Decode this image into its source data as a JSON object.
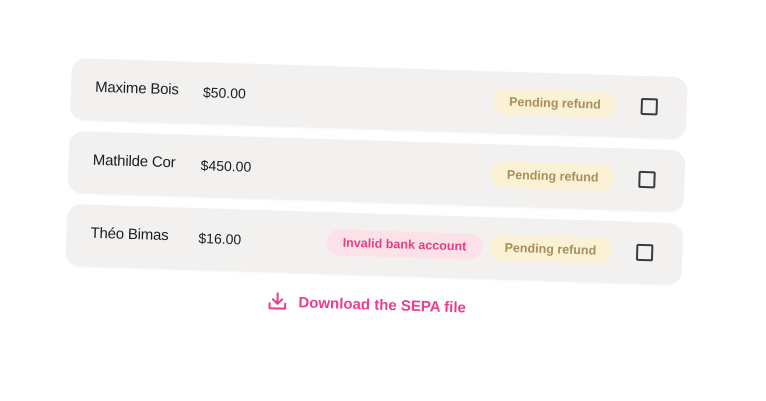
{
  "rows": [
    {
      "name": "Maxime Bois",
      "amount": "$50.00",
      "status": "Pending refund",
      "error": null
    },
    {
      "name": "Mathilde Cor",
      "amount": "$450.00",
      "status": "Pending refund",
      "error": null
    },
    {
      "name": "Théo Bimas",
      "amount": "$16.00",
      "status": "Pending refund",
      "error": "Invalid bank account"
    }
  ],
  "download_label": "Download the SEPA file",
  "icons": {
    "download": "download-icon",
    "checkbox": "checkbox"
  },
  "colors": {
    "accent": "#ea3d8c",
    "pending_bg": "#fbf2d6",
    "pending_text": "#a58f5b",
    "error_bg": "#fde1e8",
    "error_text": "#e53e82",
    "row_bg": "#f2f1f0"
  }
}
